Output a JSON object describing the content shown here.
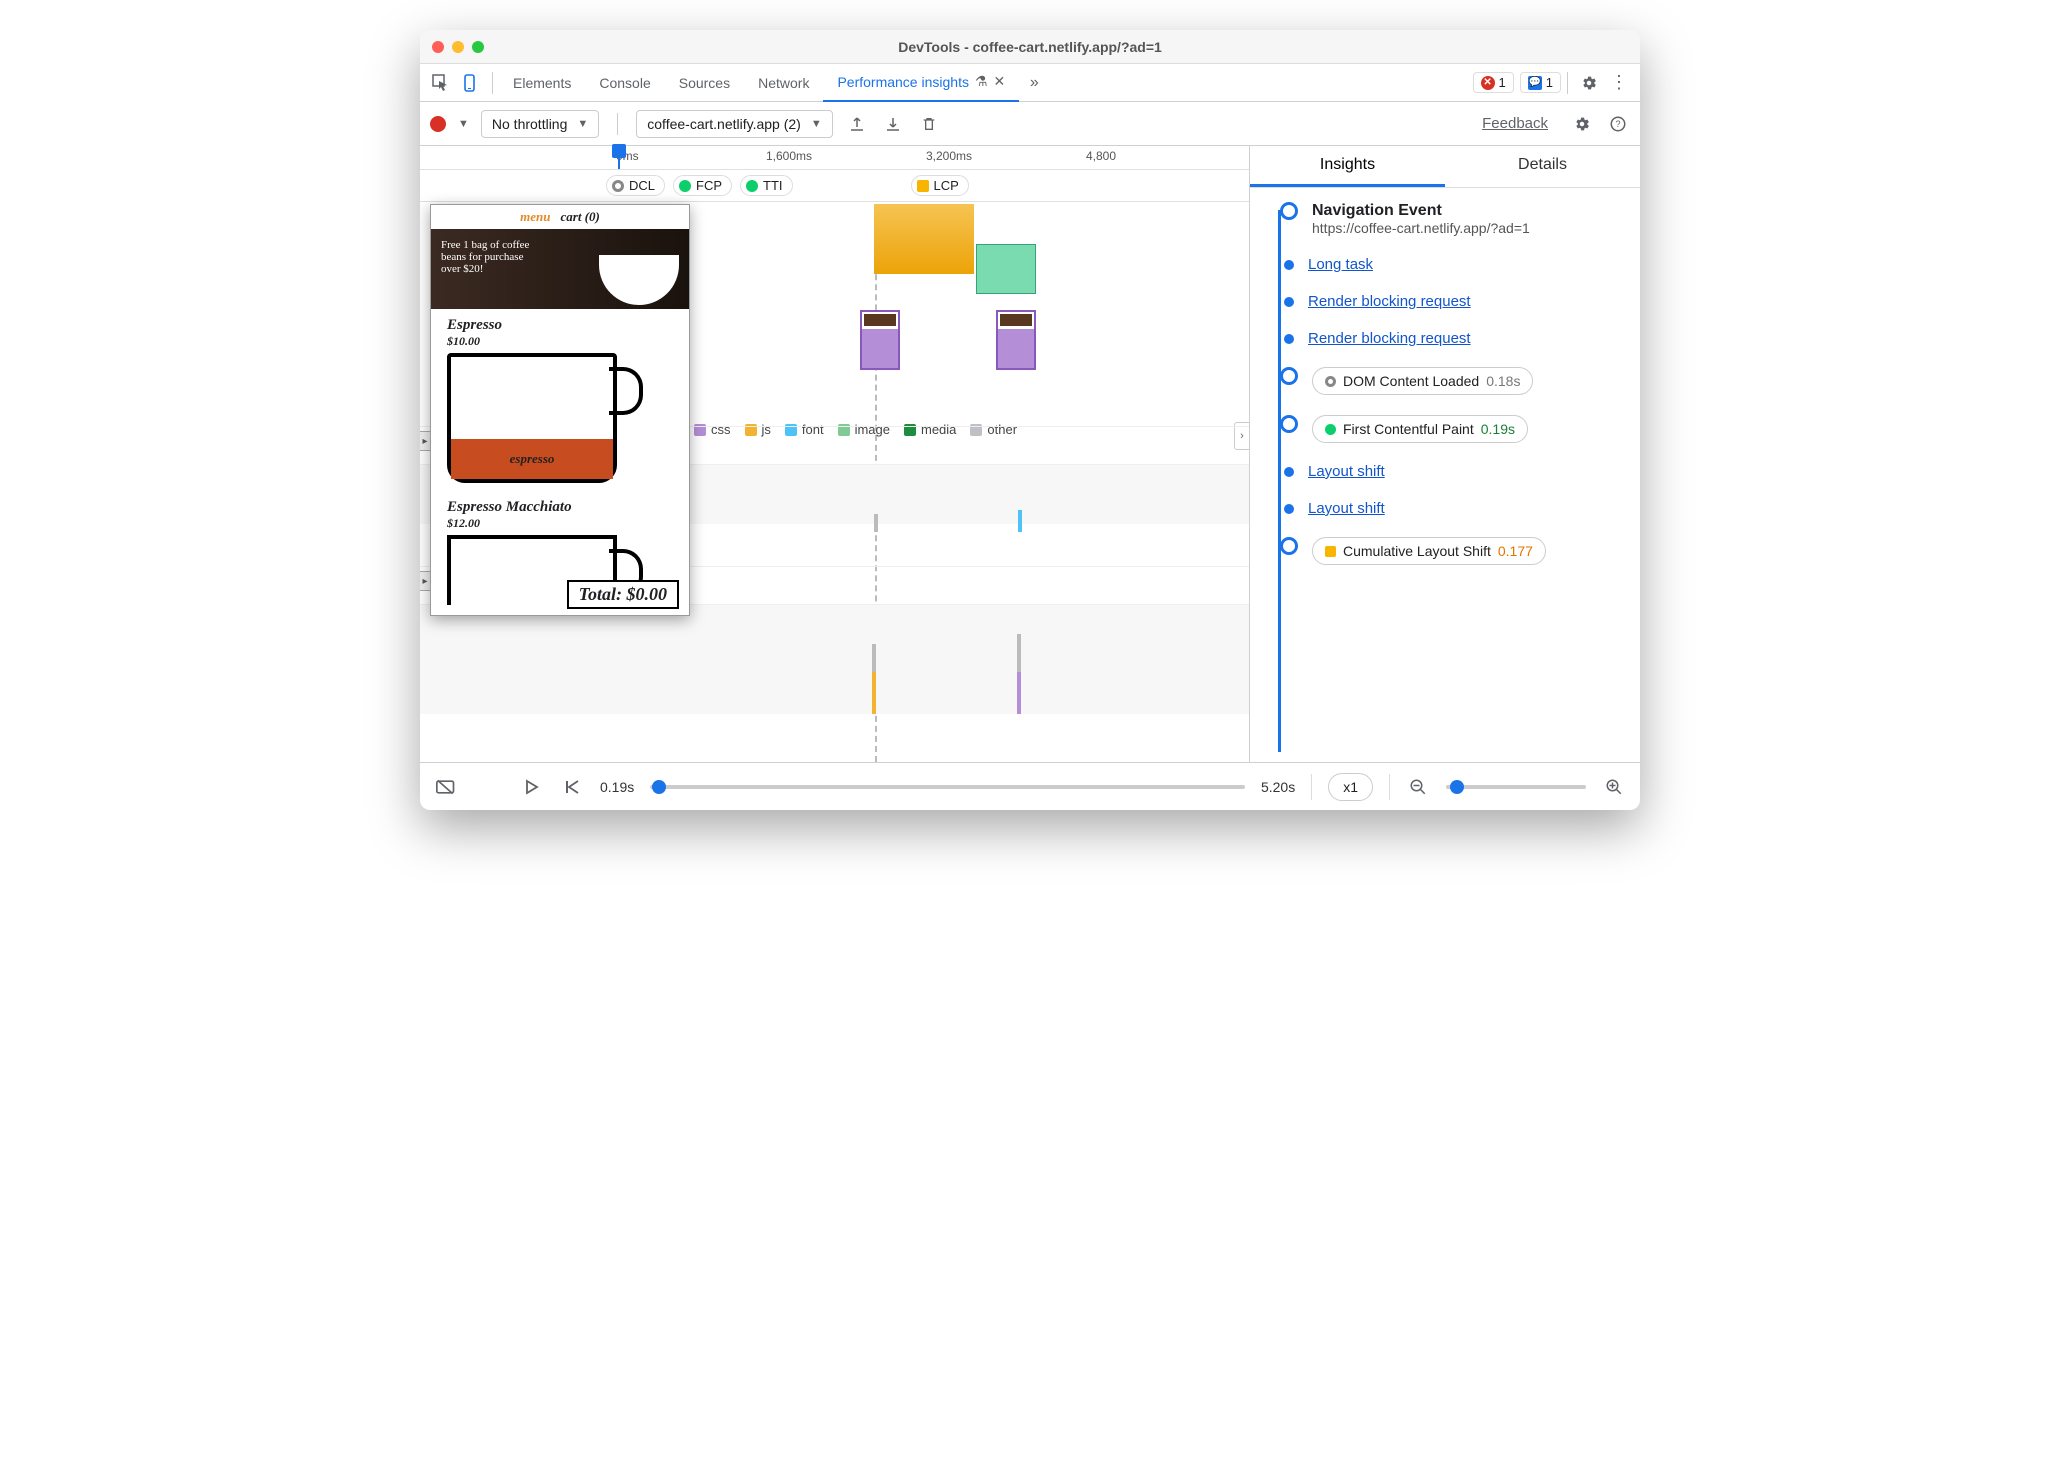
{
  "window": {
    "title": "DevTools - coffee-cart.netlify.app/?ad=1"
  },
  "tabs": {
    "items": [
      "Elements",
      "Console",
      "Sources",
      "Network",
      "Performance insights"
    ],
    "active_index": 4,
    "errors_count": "1",
    "messages_count": "1"
  },
  "toolbar": {
    "throttling": "No throttling",
    "recording": "coffee-cart.netlify.app (2)",
    "feedback": "Feedback"
  },
  "ruler": {
    "t0": "0ms",
    "t1": "1,600ms",
    "t2": "3,200ms",
    "t3": "4,800"
  },
  "markers": {
    "dcl": "DCL",
    "fcp": "FCP",
    "tti": "TTI",
    "lcp": "LCP"
  },
  "legend": {
    "css": "css",
    "js": "js",
    "font": "font",
    "image": "image",
    "media": "media",
    "other": "other"
  },
  "filmstrip": {
    "menu": "menu",
    "cart": "cart (0)",
    "banner": "Free 1 bag of coffee beans for purchase over $20!",
    "p1_name": "Espresso",
    "p1_price": "$10.00",
    "p1_label": "espresso",
    "p2_name": "Espresso Macchiato",
    "p2_price": "$12.00",
    "total": "Total: $0.00"
  },
  "right": {
    "tab_insights": "Insights",
    "tab_details": "Details",
    "nav_title": "Navigation Event",
    "nav_url": "https://coffee-cart.netlify.app/?ad=1",
    "long_task": "Long task",
    "rbr": "Render blocking request",
    "dcl_label": "DOM Content Loaded",
    "dcl_val": "0.18s",
    "fcp_label": "First Contentful Paint",
    "fcp_val": "0.19s",
    "ls": "Layout shift",
    "cls_label": "Cumulative Layout Shift",
    "cls_val": "0.177"
  },
  "footer": {
    "time_start": "0.19s",
    "time_end": "5.20s",
    "speed": "x1"
  }
}
